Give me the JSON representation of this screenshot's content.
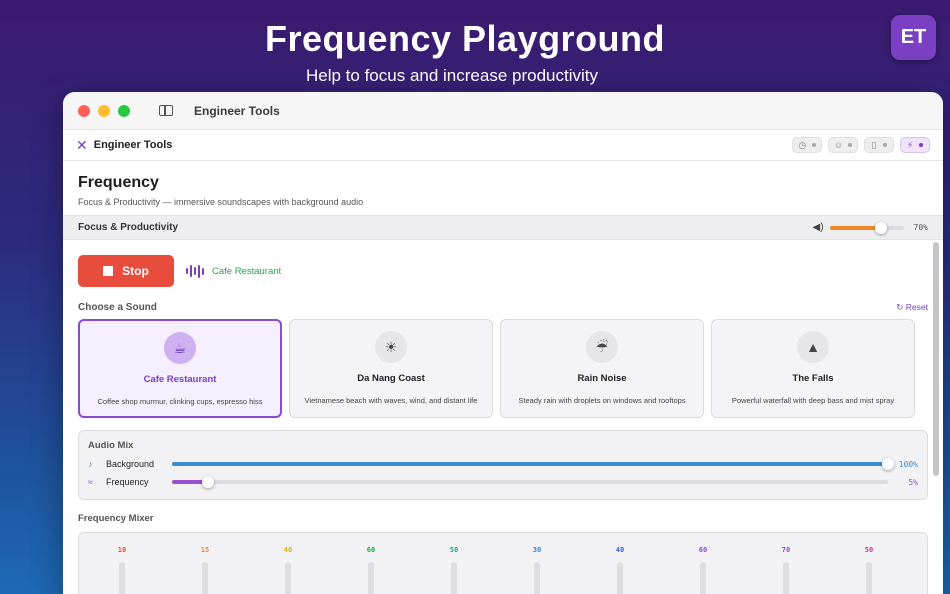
{
  "hero": {
    "title": "Frequency Playground",
    "subtitle": "Help to focus and increase productivity",
    "badge": "ET"
  },
  "window": {
    "title": "Engineer Tools",
    "traffic_lights": [
      "#ff5f57",
      "#febc2e",
      "#28c840"
    ]
  },
  "toolbar": {
    "app_name": "Engineer Tools",
    "app_icon": "tools-icon",
    "buttons": [
      {
        "icon": "timer-icon",
        "glyph": "◷",
        "active": false
      },
      {
        "icon": "group-icon",
        "glyph": "☺",
        "active": false
      },
      {
        "icon": "clipboard-icon",
        "glyph": "▯",
        "active": false
      },
      {
        "icon": "pulse-icon",
        "glyph": "⚡",
        "active": true
      }
    ]
  },
  "page": {
    "title": "Frequency",
    "subtitle": "Focus & Productivity — immersive soundscapes with background audio"
  },
  "section": {
    "label": "Focus & Productivity",
    "volume": 70,
    "volume_text": "70%"
  },
  "player": {
    "stop_label": "Stop",
    "now_playing": "Cafe Restaurant"
  },
  "sounds": {
    "label": "Choose a Sound",
    "reset_label": "Reset",
    "cards": [
      {
        "name": "Cafe Restaurant",
        "desc": "Coffee shop murmur, clinking cups, espresso hiss",
        "icon": "coffee-cup-icon",
        "glyph": "☕",
        "selected": true
      },
      {
        "name": "Da Nang Coast",
        "desc": "Vietnamese beach with waves, wind, and distant life",
        "icon": "sunrise-icon",
        "glyph": "☀",
        "selected": false
      },
      {
        "name": "Rain Noise",
        "desc": "Steady rain with droplets on windows and rooftops",
        "icon": "cloud-rain-icon",
        "glyph": "☔",
        "selected": false
      },
      {
        "name": "The Falls",
        "desc": "Powerful waterfall with deep bass and mist spray",
        "icon": "mountain-icon",
        "glyph": "▲",
        "selected": false
      }
    ]
  },
  "audio_mix": {
    "title": "Audio Mix",
    "rows": [
      {
        "label": "Background",
        "value": 100,
        "value_text": "100%",
        "color": "#3a8fd4",
        "icon": "music-note-icon",
        "glyph": "♪"
      },
      {
        "label": "Frequency",
        "value": 5,
        "value_text": "5%",
        "color": "#9a4fd0",
        "icon": "waveform-icon",
        "glyph": "≈"
      }
    ]
  },
  "frequency_mixer": {
    "label": "Frequency Mixer",
    "bands": [
      {
        "value": "10",
        "color": "#e84c3d"
      },
      {
        "value": "15",
        "color": "#ef8a26"
      },
      {
        "value": "40",
        "color": "#e6b400"
      },
      {
        "value": "60",
        "color": "#22a947"
      },
      {
        "value": "50",
        "color": "#16a89a"
      },
      {
        "value": "30",
        "color": "#2f8ed6"
      },
      {
        "value": "40",
        "color": "#3a63d4"
      },
      {
        "value": "60",
        "color": "#8a4ad6"
      },
      {
        "value": "70",
        "color": "#9a4fd0"
      },
      {
        "value": "50",
        "color": "#d03a8a"
      }
    ]
  }
}
